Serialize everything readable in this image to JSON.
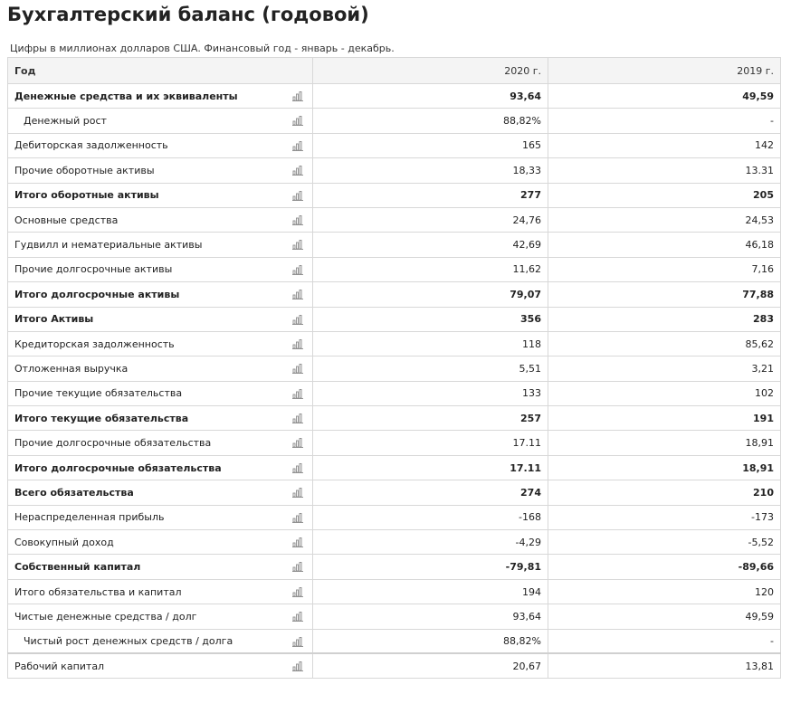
{
  "header": {
    "title": "Бухгалтерский баланс (годовой)",
    "subtitle": "Цифры в миллионах долларов США. Финансовый год - январь - декабрь."
  },
  "table": {
    "columns": [
      "Год",
      "2020 г.",
      "2019 г."
    ],
    "row_icon": "bar-chart-icon",
    "rows": [
      {
        "label": "Денежные средства и их эквиваленты",
        "v2020": "93,64",
        "v2019": "49,59",
        "bold": true,
        "indent": false
      },
      {
        "label": "Денежный рост",
        "v2020": "88,82%",
        "v2019": "-",
        "bold": false,
        "indent": true
      },
      {
        "label": "Дебиторская задолженность",
        "v2020": "165",
        "v2019": "142",
        "bold": false,
        "indent": false
      },
      {
        "label": "Прочие оборотные активы",
        "v2020": "18,33",
        "v2019": "13.31",
        "bold": false,
        "indent": false
      },
      {
        "label": "Итого оборотные активы",
        "v2020": "277",
        "v2019": "205",
        "bold": true,
        "indent": false
      },
      {
        "label": "Основные средства",
        "v2020": "24,76",
        "v2019": "24,53",
        "bold": false,
        "indent": false
      },
      {
        "label": "Гудвилл и нематериальные активы",
        "v2020": "42,69",
        "v2019": "46,18",
        "bold": false,
        "indent": false
      },
      {
        "label": "Прочие долгосрочные активы",
        "v2020": "11,62",
        "v2019": "7,16",
        "bold": false,
        "indent": false
      },
      {
        "label": "Итого долгосрочные активы",
        "v2020": "79,07",
        "v2019": "77,88",
        "bold": true,
        "indent": false
      },
      {
        "label": "Итого Активы",
        "v2020": "356",
        "v2019": "283",
        "bold": true,
        "indent": false
      },
      {
        "label": "Кредиторская задолженность",
        "v2020": "118",
        "v2019": "85,62",
        "bold": false,
        "indent": false
      },
      {
        "label": "Отложенная выручка",
        "v2020": "5,51",
        "v2019": "3,21",
        "bold": false,
        "indent": false
      },
      {
        "label": "Прочие текущие обязательства",
        "v2020": "133",
        "v2019": "102",
        "bold": false,
        "indent": false
      },
      {
        "label": "Итого текущие обязательства",
        "v2020": "257",
        "v2019": "191",
        "bold": true,
        "indent": false
      },
      {
        "label": "Прочие долгосрочные обязательства",
        "v2020": "17.11",
        "v2019": "18,91",
        "bold": false,
        "indent": false
      },
      {
        "label": "Итого долгосрочные обязательства",
        "v2020": "17.11",
        "v2019": "18,91",
        "bold": true,
        "indent": false
      },
      {
        "label": "Всего обязательства",
        "v2020": "274",
        "v2019": "210",
        "bold": true,
        "indent": false
      },
      {
        "label": "Нераспределенная прибыль",
        "v2020": "-168",
        "v2019": "-173",
        "bold": false,
        "indent": false
      },
      {
        "label": "Совокупный доход",
        "v2020": "-4,29",
        "v2019": "-5,52",
        "bold": false,
        "indent": false
      },
      {
        "label": "Собственный капитал",
        "v2020": "-79,81",
        "v2019": "-89,66",
        "bold": true,
        "indent": false
      },
      {
        "label": "Итого обязательства и капитал",
        "v2020": "194",
        "v2019": "120",
        "bold": false,
        "indent": false
      },
      {
        "label": "Чистые денежные средства / долг",
        "v2020": "93,64",
        "v2019": "49,59",
        "bold": false,
        "indent": false
      },
      {
        "label": "Чистый рост денежных средств / долга",
        "v2020": "88,82%",
        "v2019": "-",
        "bold": false,
        "indent": true
      },
      {
        "label": "Рабочий капитал",
        "v2020": "20,67",
        "v2019": "13,81",
        "bold": false,
        "indent": false,
        "separator": true
      }
    ]
  }
}
